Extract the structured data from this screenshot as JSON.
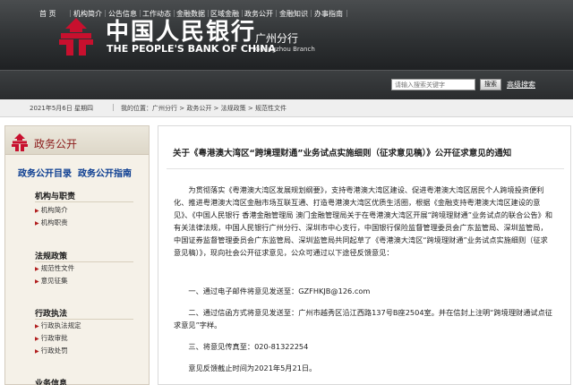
{
  "header": {
    "bank_name_cn": "中国人民银行",
    "bank_name_en": "THE PEOPLE'S BANK OF CHINA",
    "branch_cn": "广州分行",
    "branch_en": "Guangzhou Branch",
    "logo_icon": "pboc-logo-icon",
    "banner_color": "#2f3234"
  },
  "nav": {
    "items": [
      "首 页",
      "机构简介",
      "公告信息",
      "工作动态",
      "金融数据",
      "区域金融",
      "政务公开",
      "金融知识",
      "办事指南"
    ],
    "search_placeholder": "请输入搜索关键字",
    "search_button": "搜索",
    "advanced_search": "高级搜索"
  },
  "breadcrumb": {
    "date": "2021年5月6日 星期四",
    "path": "我的位置：广州分行 > 政务公开 > 法规政策 > 规范性文件"
  },
  "sidebar": {
    "title": "政务公开",
    "dir_link_1": "政务公开目录",
    "dir_link_2": "政务公开指南",
    "sections": [
      {
        "title": "机构与职责",
        "items": [
          "机构简介",
          "机构职责"
        ]
      },
      {
        "title": "法规政策",
        "items": [
          "规范性文件",
          "意见征集"
        ]
      },
      {
        "title": "行政执法",
        "items": [
          "行政执法规定",
          "行政审批",
          "行政处罚"
        ]
      },
      {
        "title": "业务信息",
        "items": []
      }
    ],
    "accent_color": "#8b1a1a"
  },
  "article": {
    "title": "关于《粤港澳大湾区“跨境理财通”业务试点实施细则（征求意见稿）》公开征求意见的通知",
    "paragraphs": [
      "为贯彻落实《粤港澳大湾区发展规划纲要》，支持粤港澳大湾区建设、促进粤港澳大湾区居民个人跨境投资便利化、推进粤港澳大湾区金融市场互联互通、打造粤港澳大湾区优质生活圈，根据《金融支持粤港澳大湾区建设的意见》、《中国人民银行 香港金融管理局 澳门金融管理局关于在粤港澳大湾区开展“跨境理财通”业务试点的联合公告》和有关法律法规，中国人民银行广州分行、深圳市中心支行，中国银行保险监督管理委员会广东监管局、深圳监管局，中国证券监督管理委员会广东监管局、深圳监管局共同起草了《粤港澳大湾区“跨境理财通”业务试点实施细则（征求意见稿）》，现向社会公开征求意见，公众可通过以下途径反馈意见：",
      "一、通过电子邮件将意见发送至：GZFHKJB@126.com",
      "二、通过信函方式将意见发送至：广州市越秀区沿江西路137号B座2504室。并在信封上注明“跨境理财通试点征求意见”字样。",
      "三、将意见传真至：020-81322254",
      "意见反馈截止时间为2021年5月21日。"
    ]
  }
}
